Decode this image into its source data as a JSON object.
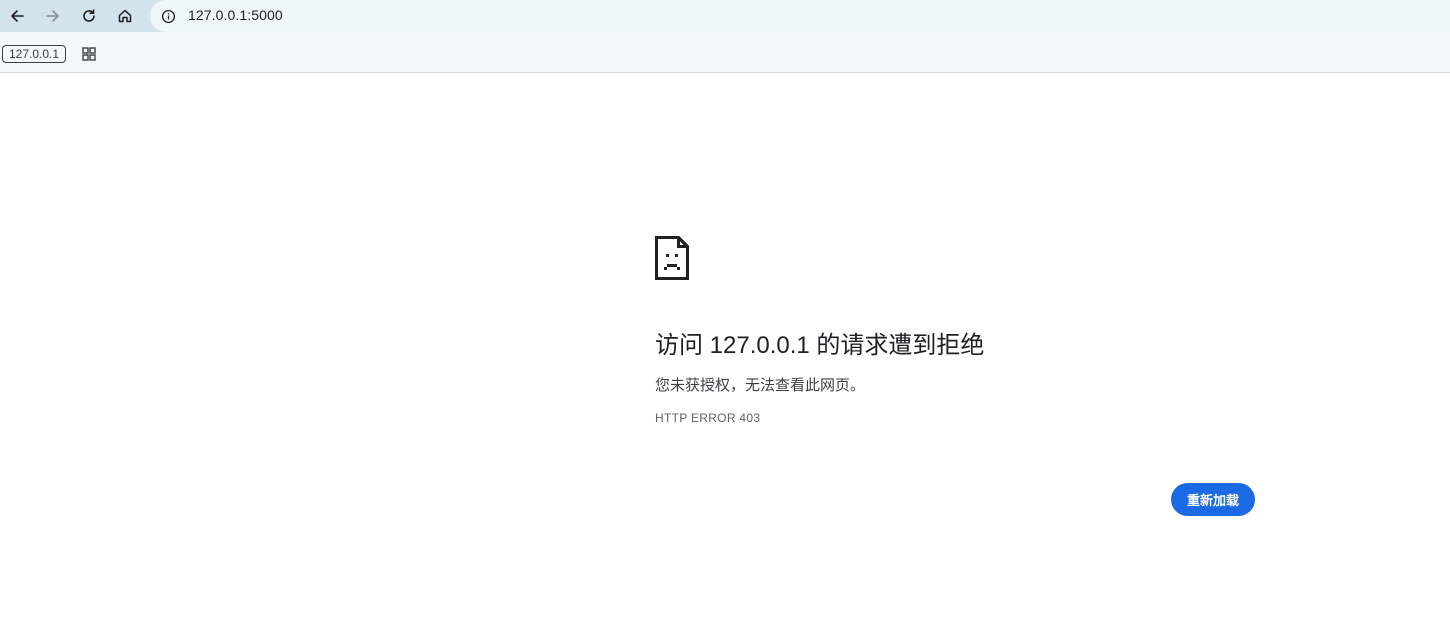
{
  "toolbar": {
    "back_icon": "arrow-left-icon",
    "forward_icon": "arrow-right-icon",
    "reload_icon": "reload-icon",
    "home_icon": "home-icon"
  },
  "omnibox": {
    "info_icon": "info-icon",
    "url": "127.0.0.1:5000"
  },
  "bookmarks": {
    "chip_label": "127.0.0.1",
    "apps_icon": "apps-grid-icon"
  },
  "error_page": {
    "icon": "sad-page-icon",
    "title": "访问 127.0.0.1 的请求遭到拒绝",
    "description": "您未获授权，无法查看此网页。",
    "error_code": "HTTP ERROR 403",
    "reload_button_label": "重新加载"
  },
  "colors": {
    "toolbar_bg": "#d3e3ec",
    "omnibox_bg": "#f0f7fa",
    "reload_button_bg": "#1b6ae4"
  }
}
